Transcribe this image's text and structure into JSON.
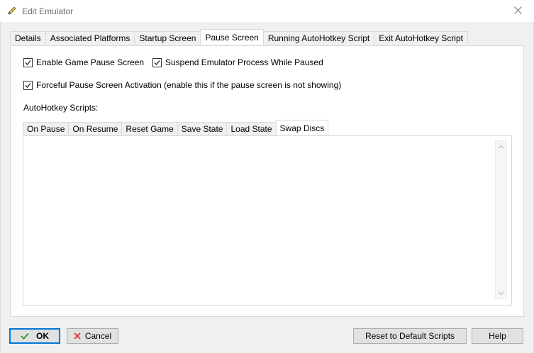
{
  "window": {
    "title": "Edit Emulator"
  },
  "tabs": [
    {
      "label": "Details"
    },
    {
      "label": "Associated Platforms"
    },
    {
      "label": "Startup Screen"
    },
    {
      "label": "Pause Screen"
    },
    {
      "label": "Running AutoHotkey Script"
    },
    {
      "label": "Exit AutoHotkey Script"
    }
  ],
  "pause": {
    "enable_label": "Enable Game Pause Screen",
    "suspend_label": "Suspend Emulator Process While Paused",
    "forceful_label": "Forceful Pause Screen Activation (enable this if the pause screen is not showing)",
    "scripts_label": "AutoHotkey Scripts:"
  },
  "subtabs": [
    {
      "label": "On Pause"
    },
    {
      "label": "On Resume"
    },
    {
      "label": "Reset Game"
    },
    {
      "label": "Save State"
    },
    {
      "label": "Load State"
    },
    {
      "label": "Swap Discs"
    }
  ],
  "buttons": {
    "ok": "OK",
    "cancel": "Cancel",
    "reset": "Reset to Default Scripts",
    "help": "Help"
  },
  "colors": {
    "accent": "#0078d7",
    "ok_check": "#2e9e2e",
    "cancel_x": "#d93025"
  }
}
